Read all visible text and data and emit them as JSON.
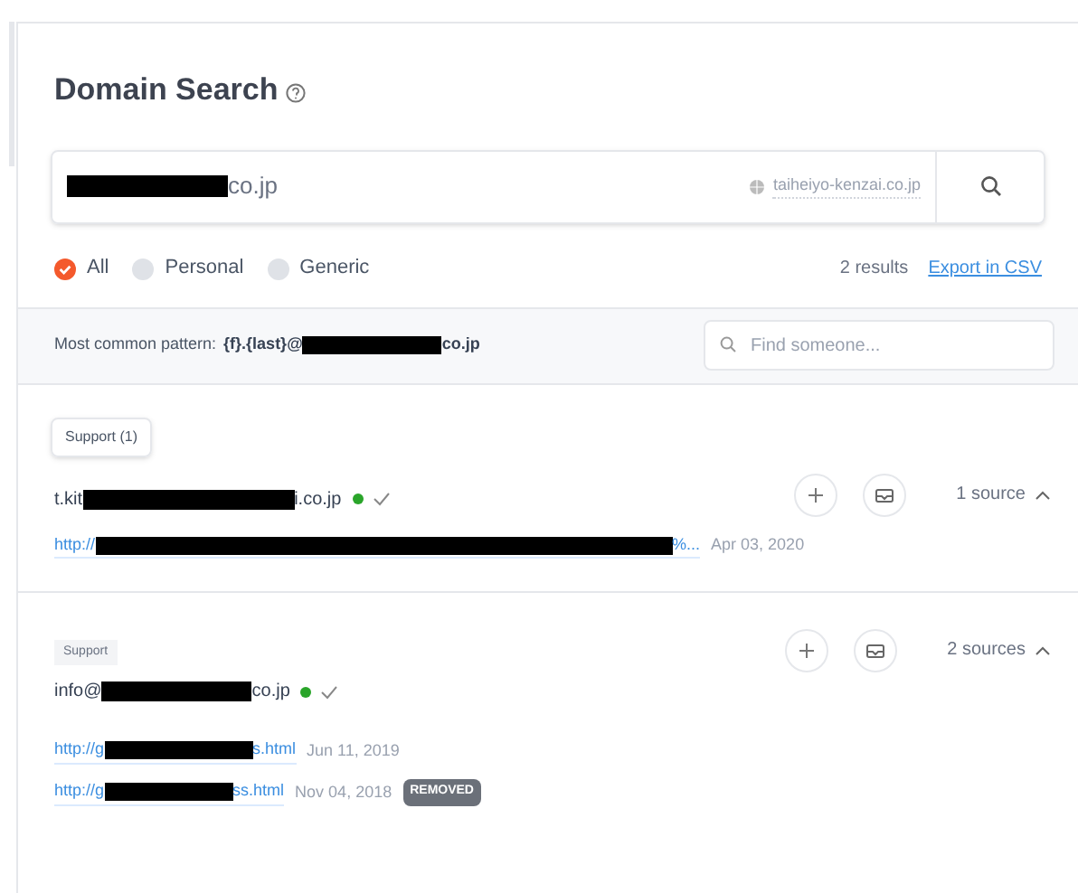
{
  "title": "Domain Search",
  "search": {
    "value_suffix": "co.jp",
    "domain_hint": "taiheiyo-kenzai.co.jp"
  },
  "filters": [
    {
      "label": "All",
      "selected": true
    },
    {
      "label": "Personal",
      "selected": false
    },
    {
      "label": "Generic",
      "selected": false
    }
  ],
  "results_count": "2 results",
  "export_link": "Export in CSV",
  "pattern": {
    "label": "Most common pattern:",
    "prefix": "{f}.{last}@",
    "suffix": "co.jp"
  },
  "find_field": {
    "placeholder": "Find someone..."
  },
  "department_tag": "Support (1)",
  "emails": [
    {
      "prefix": "t.kit",
      "suffix": "i.co.jp",
      "verified": true,
      "sources_label": "1 source",
      "expanded": true,
      "sources": [
        {
          "prefix": "http://",
          "suffix": "%...",
          "date": "Apr 03, 2020",
          "removed": false
        }
      ]
    },
    {
      "department": "Support",
      "prefix": "info@",
      "suffix": "co.jp",
      "verified": true,
      "sources_label": "2 sources",
      "expanded": true,
      "sources": [
        {
          "prefix": "http://g",
          "suffix": "s.html",
          "date": "Jun 11, 2019",
          "removed": false
        },
        {
          "prefix": "http://g",
          "suffix": "ss.html",
          "date": "Nov 04, 2018",
          "removed": true,
          "removed_label": "REMOVED"
        }
      ]
    }
  ]
}
